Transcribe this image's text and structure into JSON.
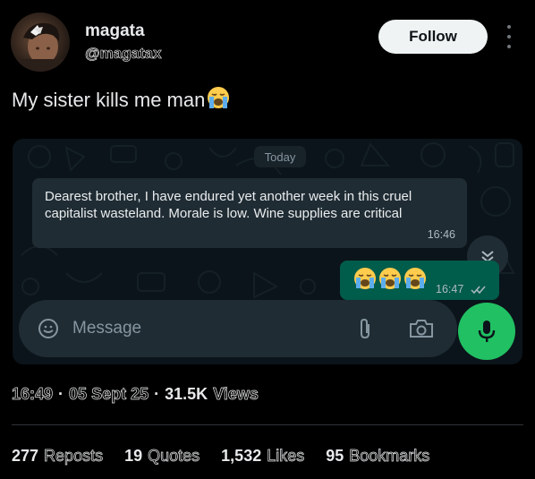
{
  "author": {
    "name": "magata",
    "handle": "@magatax",
    "follow_label": "Follow"
  },
  "tweet": {
    "text": "My sister kills me man",
    "emoji": "loudly-crying-face"
  },
  "chat": {
    "date_chip": "Today",
    "incoming": {
      "text": "Dearest brother, I have endured yet another week in this cruel capitalist wasteland. Morale is low. Wine supplies are critical",
      "time": "16:46"
    },
    "outgoing": {
      "emojis": [
        "loudly-crying-face",
        "loudly-crying-face",
        "loudly-crying-face"
      ],
      "time": "16:47"
    },
    "input_placeholder": "Message"
  },
  "meta": {
    "time": "16:49",
    "date": "05 Sept 25",
    "views_count": "31.5K",
    "views_label": "Views"
  },
  "stats": [
    {
      "count": "277",
      "label": "Reposts"
    },
    {
      "count": "19",
      "label": "Quotes"
    },
    {
      "count": "1,532",
      "label": "Likes"
    },
    {
      "count": "95",
      "label": "Bookmarks"
    }
  ],
  "colors": {
    "background": "#000000",
    "chat_bg": "#0b141a",
    "bubble_in": "#202c33",
    "bubble_out": "#005c4b",
    "mic_button": "#21c063",
    "follow_bg": "#eff3f4"
  }
}
